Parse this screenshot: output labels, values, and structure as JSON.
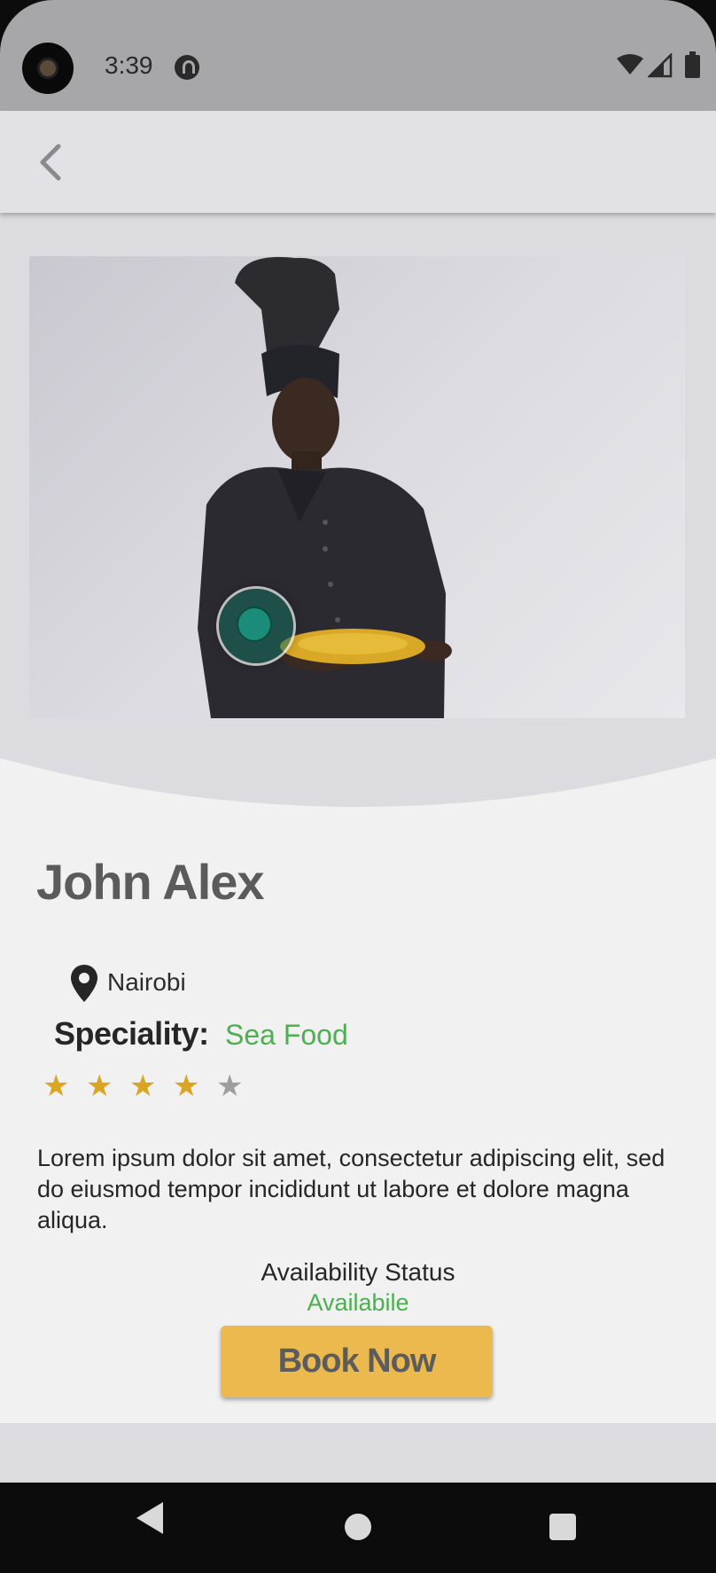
{
  "status_bar": {
    "time": "3:39"
  },
  "chef": {
    "name": "John Alex",
    "location": "Nairobi",
    "speciality_label": "Speciality:",
    "speciality_value": "Sea Food",
    "rating": 4,
    "max_rating": 5,
    "description": "Lorem ipsum dolor sit amet, consectetur adipiscing elit, sed do eiusmod tempor incididunt ut labore et dolore magna aliqua.",
    "availability_label": "Availability Status",
    "availability_value": "Availabile"
  },
  "actions": {
    "book_label": "Book Now"
  },
  "colors": {
    "accent_green": "#4caf50",
    "button_yellow": "#ecb94e",
    "star_filled": "#daa520",
    "star_empty": "#9e9e9e"
  },
  "icons": {
    "back": "chevron-left-icon",
    "location": "location-pin-icon",
    "star": "star-icon"
  }
}
